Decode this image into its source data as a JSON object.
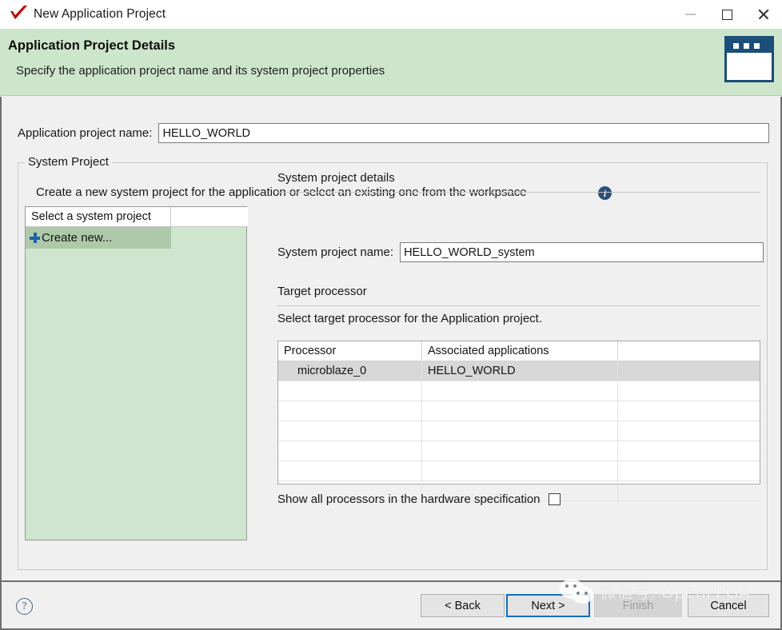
{
  "window": {
    "title": "New Application Project",
    "icon": "vitis-check-icon",
    "controls": {
      "minimize": "minimize-icon",
      "maximize": "maximize-icon",
      "close": "close-icon"
    }
  },
  "banner": {
    "title": "Application Project Details",
    "subtitle": "Specify the application project name and its system project properties",
    "icon": "window-dialog-icon",
    "accent_color": "#cde5cb",
    "icon_color": "#1b4e79"
  },
  "form": {
    "app_name_label": "Application project name:",
    "app_name_value": "HELLO_WORLD",
    "app_name_placeholder": ""
  },
  "system_project_group": {
    "legend": "System Project",
    "description": "Create a new system project for the application or select an existing one from the workpsace",
    "info_icon": "info-icon",
    "list": {
      "header": "Select a system project",
      "items": [
        {
          "label": "Create new...",
          "icon": "plus-icon",
          "selected": true
        }
      ]
    },
    "details": {
      "section_title": "System project details",
      "name_label": "System project name:",
      "name_value": "HELLO_WORLD_system",
      "name_placeholder": ""
    },
    "target_processor": {
      "section_title": "Target processor",
      "description": "Select target processor for the Application project.",
      "columns": [
        "Processor",
        "Associated applications",
        ""
      ],
      "rows": [
        {
          "processor": "microblaze_0",
          "applications": "HELLO_WORLD",
          "extra": "",
          "selected": true
        },
        {
          "processor": "",
          "applications": "",
          "extra": "",
          "selected": false
        },
        {
          "processor": "",
          "applications": "",
          "extra": "",
          "selected": false
        },
        {
          "processor": "",
          "applications": "",
          "extra": "",
          "selected": false
        },
        {
          "processor": "",
          "applications": "",
          "extra": "",
          "selected": false
        },
        {
          "processor": "",
          "applications": "",
          "extra": "",
          "selected": false
        },
        {
          "processor": "",
          "applications": "",
          "extra": "",
          "selected": false
        }
      ],
      "show_all_label": "Show all processors in the hardware specification",
      "show_all_checked": false,
      "info_icon": "info-icon"
    }
  },
  "footer": {
    "help_icon": "help-question-icon",
    "buttons": [
      {
        "id": "back",
        "label": "< Back",
        "state": "enabled"
      },
      {
        "id": "next",
        "label": "Next >",
        "state": "focused"
      },
      {
        "id": "finish",
        "label": "Finish",
        "state": "disabled"
      },
      {
        "id": "cancel",
        "label": "Cancel",
        "state": "enabled"
      }
    ]
  },
  "watermark": {
    "text": "微信号: OpenFPGA",
    "icon": "wechat-icon"
  }
}
